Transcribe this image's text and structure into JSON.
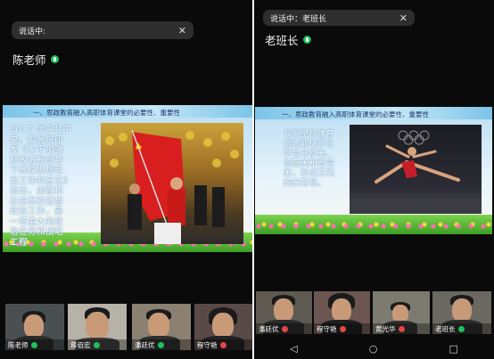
{
  "left": {
    "status": {
      "text": "说话中:",
      "close": "✕"
    },
    "speaker": "陈老师",
    "slide": {
      "title": "一、思政教育融入高职体育课堂的必要性、重要性",
      "body_lines": [
        "2017 年中共中",
        "央、国务院印",
        "发《关于加强",
        "和改进新形势",
        "下高校思想政",
        "治工作的意见》",
        "指出，加强和",
        "改进高校思想",
        "政治工作，是",
        "一项重大的政",
        "治任务和战略",
        "工程"
      ]
    },
    "participants": [
      {
        "name": "陈老师",
        "mic": "on"
      },
      {
        "name": "蒋佰宏",
        "mic": "on"
      },
      {
        "name": "潘廷优",
        "mic": "on"
      },
      {
        "name": "程守艳",
        "mic": "off"
      }
    ]
  },
  "right": {
    "status": {
      "text": "说话中：老班长",
      "close": "✕"
    },
    "speaker": "老班长",
    "slide": {
      "title": "一、思政教育融入高职体育课堂的必要性、重要性",
      "body_lines": [
        "长期坚持体育",
        "锻炼能使学生",
        "学会分析美、",
        "创造美和鉴赏",
        "美，形成正确",
        "的美育观。"
      ]
    },
    "participants": [
      {
        "name": "潘廷优",
        "mic": "off"
      },
      {
        "name": "程守艳",
        "mic": "off"
      },
      {
        "name": "黄光华",
        "mic": "off"
      },
      {
        "name": "老班长",
        "mic": "on"
      }
    ],
    "nav": {
      "back": "◁",
      "home": "○",
      "recent": "□"
    }
  },
  "colors": {
    "mic_on": "#1fbf5a",
    "mic_off": "#e14848",
    "bg": "#0a0a0a"
  }
}
